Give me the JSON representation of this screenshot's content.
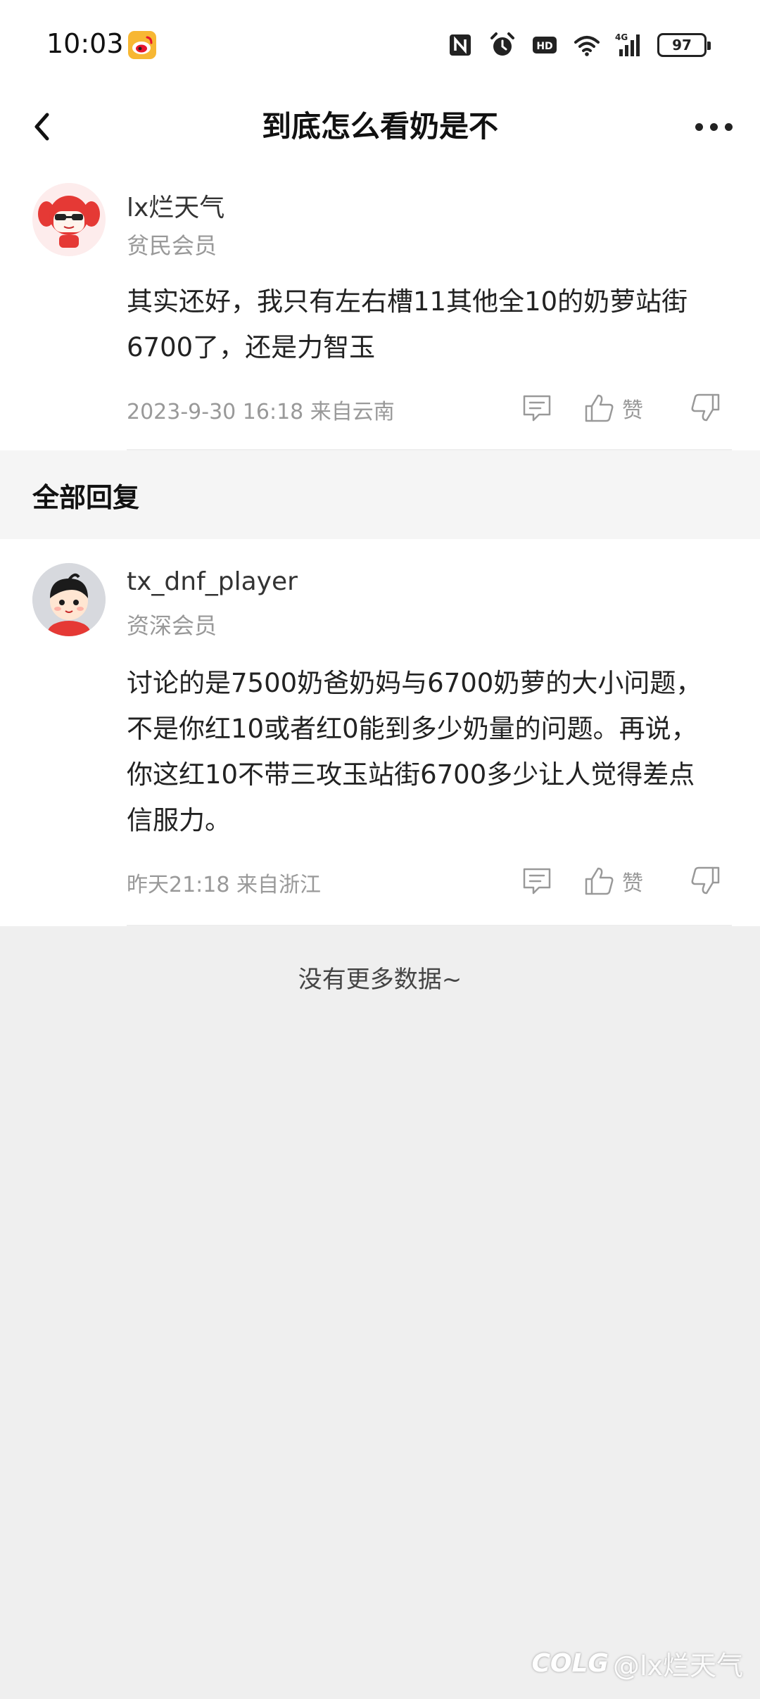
{
  "status_bar": {
    "time": "10:03",
    "battery": "97",
    "icons": [
      "weibo-icon",
      "nfc-icon",
      "alarm-icon",
      "hd-icon",
      "wifi-icon",
      "signal-4g-icon",
      "battery-icon"
    ]
  },
  "header": {
    "title": "到底怎么看奶是不"
  },
  "main_comment": {
    "username": "lx烂天气",
    "member": "贫民会员",
    "content": "其实还好，我只有左右槽11其他全10的奶萝站街6700了，还是力智玉",
    "meta": "2023-9-30 16:18  来自云南",
    "like_label": "赞"
  },
  "section": {
    "title": "全部回复"
  },
  "replies": [
    {
      "username": "tx_dnf_player",
      "member": "资深会员",
      "content": "讨论的是7500奶爸奶妈与6700奶萝的大小问题，不是你红10或者红0能到多少奶量的问题。再说，你这红10不带三攻玉站街6700多少让人觉得差点信服力。",
      "meta": "昨天21:18 来自浙江",
      "like_label": "赞"
    }
  ],
  "footer": {
    "no_more": "没有更多数据~"
  },
  "watermark": {
    "logo": "COLG",
    "text": "@lx烂天气"
  },
  "colors": {
    "background": "#efefef",
    "card": "#ffffff",
    "muted_text": "#999999",
    "avatar_accent": "#e53935"
  }
}
